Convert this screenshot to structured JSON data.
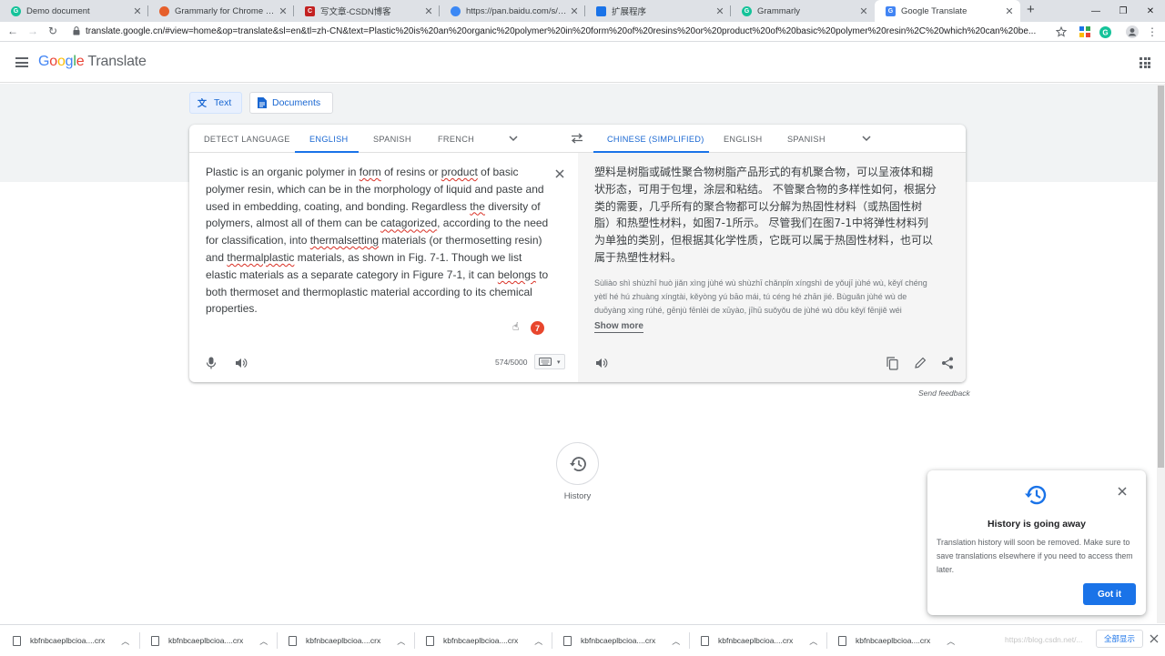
{
  "browser": {
    "tabs": [
      {
        "title": "Demo document",
        "icon": "grammarly-icon",
        "color": "#15c39a"
      },
      {
        "title": "Grammarly for Chrome - Chrome",
        "icon": "chrome-webstore-icon",
        "color": "#e65f2b"
      },
      {
        "title": "写文章-CSDN博客",
        "icon": "csdn-icon",
        "color": "#c32121"
      },
      {
        "title": "https://pan.baidu.com/s/1kO...",
        "icon": "baidu-pan-icon",
        "color": "#3b88f5"
      },
      {
        "title": "扩展程序",
        "icon": "puzzle-icon",
        "color": "#1a73e8"
      },
      {
        "title": "Grammarly",
        "icon": "grammarly-icon",
        "color": "#15c39a"
      },
      {
        "title": "Google Translate",
        "icon": "google-translate-icon",
        "color": "#4285f4"
      }
    ],
    "url": "translate.google.cn/#view=home&op=translate&sl=en&tl=zh-CN&text=Plastic%20is%20an%20organic%20polymer%20in%20form%20of%20resins%20or%20product%20of%20basic%20polymer%20resin%2C%20which%20can%20be..."
  },
  "app": {
    "logo_word": [
      "G",
      "o",
      "o",
      "g",
      "l",
      "e"
    ],
    "product": "Translate"
  },
  "modes": {
    "text": "Text",
    "documents": "Documents"
  },
  "source_langs": [
    "DETECT LANGUAGE",
    "ENGLISH",
    "SPANISH",
    "FRENCH"
  ],
  "target_langs": [
    "CHINESE (SIMPLIFIED)",
    "ENGLISH",
    "SPANISH"
  ],
  "source": {
    "segments": [
      "Plastic is an organic polymer in ",
      "form",
      " of resins or ",
      "product",
      " of basic polymer resin, which can be in the morphology of liquid and paste and used in embedding, coating, and bonding. Regardless ",
      "the",
      " diversity of polymers, almost all of them can be ",
      "catagorized",
      ", according to the need for classification, into ",
      "thermalsetting",
      " materials (or thermosetting resin) and ",
      "thermalplastic",
      " materials, as shown in Fig. 7-1. Though we list elastic materials as a separate category in Figure 7-1, it can ",
      "belongs",
      " to both thermoset and thermoplastic material according to its chemical properties."
    ],
    "char_count": "574/5000",
    "grammarly_count": "7"
  },
  "target": {
    "text": "塑料是树脂或碱性聚合物树脂产品形式的有机聚合物，可以呈液体和糊状形态，可用于包埋，涂层和粘结。 不管聚合物的多样性如何，根据分类的需要，几乎所有的聚合物都可以分解为热固性材料（或热固性树脂）和热塑性材料，如图7-1所示。 尽管我们在图7-1中将弹性材料列为单独的类别，但根据其化学性质，它既可以属于热固性材料，也可以属于热塑性材料。",
    "transliteration": "Sùliào shì shùzhī huò jiǎn xìng jùhé wù shùzhī chǎnpǐn xíngshì de yǒujī jùhé wù, kěyǐ chéng yètǐ hé hú zhuàng xíngtài, kěyòng yú bāo mái, tú céng hé zhān jié. Bùguǎn jùhé wù de duōyàng xìng rúhé, gēnjù fēnlèi de xūyào, jīhū suǒyǒu de jùhé wù dōu kěyǐ fēnjiě wéi",
    "show_more": "Show more"
  },
  "feedback": "Send feedback",
  "history": {
    "label": "History"
  },
  "popup": {
    "title": "History is going away",
    "body": "Translation history will soon be removed. Make sure to save translations elsewhere if you need to access them later.",
    "button": "Got it"
  },
  "downloads": {
    "items": [
      "kbfnbcaeplbcioa....crx",
      "kbfnbcaeplbcioa....crx",
      "kbfnbcaeplbcioa....crx",
      "kbfnbcaeplbcioa....crx",
      "kbfnbcaeplbcioa....crx",
      "kbfnbcaeplbcioa....crx",
      "kbfnbcaeplbcioa....crx"
    ],
    "show_all": "全部显示",
    "watermark": "https://blog.csdn.net/..."
  },
  "colors": {
    "accent": "#1a73e8",
    "error_underline": "#d93025",
    "grammarly_badge": "#e8462d"
  }
}
